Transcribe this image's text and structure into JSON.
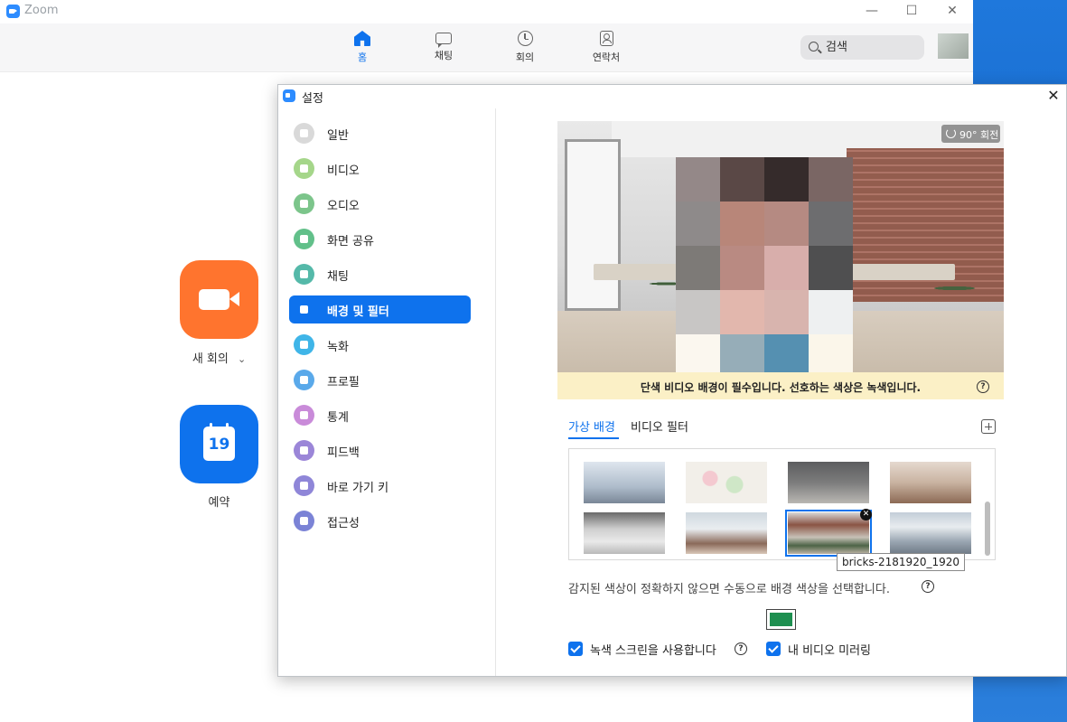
{
  "app": {
    "title": "Zoom",
    "minimize": "—",
    "maximize": "☐",
    "close": "✕"
  },
  "nav": [
    {
      "label": "홈",
      "icon": "home-icon",
      "active": true
    },
    {
      "label": "채팅",
      "icon": "chat-icon"
    },
    {
      "label": "회의",
      "icon": "clock-icon"
    },
    {
      "label": "연락처",
      "icon": "contacts-icon"
    }
  ],
  "search": {
    "placeholder": "검색"
  },
  "home": {
    "new_meeting": {
      "label": "새 회의",
      "chevron": "⌄",
      "color": "#ff742e"
    },
    "schedule": {
      "label": "예약",
      "day": "19",
      "color": "#0e72ed"
    }
  },
  "dialog": {
    "title": "설정",
    "close": "✕",
    "sidebar": [
      {
        "label": "일반",
        "icon": "gear-icon",
        "color": "#d9d9d9"
      },
      {
        "label": "비디오",
        "icon": "video-icon",
        "color": "#a5d68a"
      },
      {
        "label": "오디오",
        "icon": "headphones-icon",
        "color": "#7cc58b"
      },
      {
        "label": "화면 공유",
        "icon": "share-screen-icon",
        "color": "#62c08a"
      },
      {
        "label": "채팅",
        "icon": "chat-icon",
        "color": "#55b9a9"
      },
      {
        "label": "배경 및 필터",
        "icon": "background-icon",
        "color": "#0e72ed",
        "active": true
      },
      {
        "label": "녹화",
        "icon": "record-icon",
        "color": "#3fb5e8"
      },
      {
        "label": "프로필",
        "icon": "profile-icon",
        "color": "#5aa9ea"
      },
      {
        "label": "통계",
        "icon": "stats-icon",
        "color": "#c98bd9"
      },
      {
        "label": "피드백",
        "icon": "feedback-icon",
        "color": "#9b86d8"
      },
      {
        "label": "바로 가기 키",
        "icon": "keyboard-icon",
        "color": "#8f86d8"
      },
      {
        "label": "접근성",
        "icon": "accessibility-icon",
        "color": "#7b83d6"
      }
    ],
    "preview": {
      "rotate_label": "90° 회전"
    },
    "notice": "단색 비디오 배경이 필수입니다. 선호하는 색상은 녹색입니다.",
    "tabs": [
      {
        "label": "가상 배경",
        "active": true
      },
      {
        "label": "비디오 필터"
      }
    ],
    "tooltip": "bricks-2181920_1920",
    "description": "감지된 색상이 정확하지 않으면 수동으로 배경 색상을 선택합니다.",
    "swatch_color": "#1e8f50",
    "checkboxes": [
      {
        "label": "녹색 스크린을 사용합니다",
        "checked": true
      },
      {
        "label": "내 비디오 미러링",
        "checked": true
      }
    ],
    "help_mark": "?",
    "remove_mark": "✕"
  }
}
